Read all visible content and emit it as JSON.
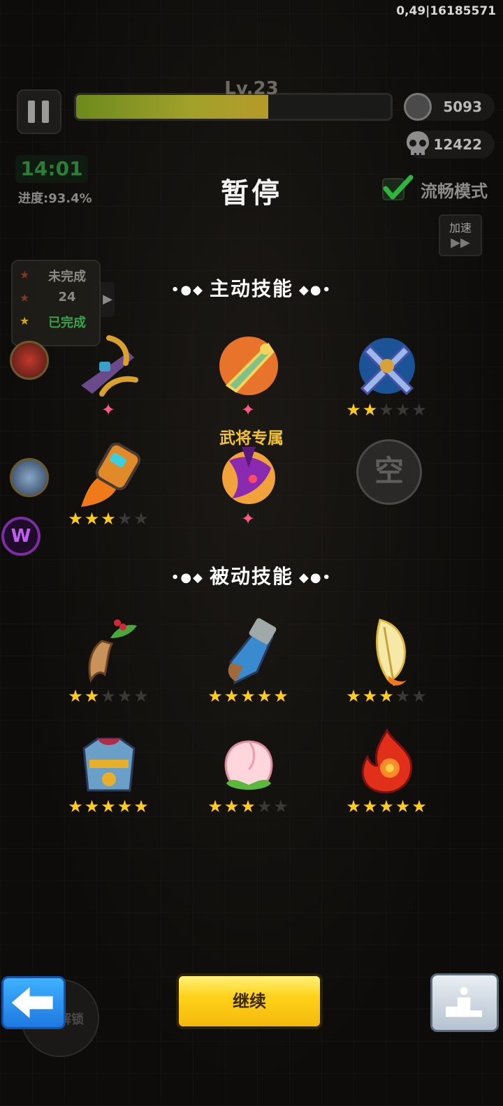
{
  "debug_text": "0,49|16185571",
  "hud": {
    "level": "Lv.23",
    "xp_fraction": 0.61,
    "coins": "5093",
    "kills": "12422",
    "timer": "14:01",
    "progress": "进度:93.4%"
  },
  "pause_title": "暂停",
  "smooth_mode": {
    "label": "流畅模式",
    "checked": true
  },
  "speed_button": {
    "label": "加速",
    "icon": "fast-forward-icon"
  },
  "quest": {
    "rows": [
      {
        "label": "未完成",
        "star_color": "#7a3a22",
        "text_color": "#8c8a86"
      },
      {
        "label": "24",
        "star_color": "#7a3a22",
        "text_color": "#8c8a86"
      },
      {
        "label": "已完成",
        "star_color": "#d5a21a",
        "text_color": "#3aa24a"
      }
    ]
  },
  "active_section": {
    "title": "主动技能",
    "dots_left": "•●◆",
    "dots_right": "◆●•"
  },
  "passive_section": {
    "title": "被动技能",
    "dots_left": "•●◆",
    "dots_right": "◆●•"
  },
  "exclusive_label": "武将专属",
  "empty_slot_label": "空",
  "active_skills": [
    {
      "icon": "crossbow-icon",
      "kind": "pink",
      "stars": 1,
      "max": 1
    },
    {
      "icon": "jade-sword-icon",
      "kind": "pink",
      "stars": 1,
      "max": 1
    },
    {
      "icon": "blue-crossed-swords-icon",
      "kind": "gold",
      "stars": 2,
      "max": 5
    },
    {
      "icon": "rocket-fist-icon",
      "kind": "gold",
      "stars": 3,
      "max": 5
    },
    {
      "icon": "dark-blade-icon",
      "kind": "pink",
      "stars": 1,
      "max": 1
    },
    {
      "icon": "empty-slot",
      "kind": "empty",
      "stars": 0,
      "max": 0
    }
  ],
  "passive_skills": [
    {
      "icon": "ginseng-icon",
      "stars": 2,
      "max": 5
    },
    {
      "icon": "gauntlet-icon",
      "stars": 5,
      "max": 5
    },
    {
      "icon": "feather-icon",
      "stars": 3,
      "max": 5
    },
    {
      "icon": "armor-icon",
      "stars": 5,
      "max": 5
    },
    {
      "icon": "peach-icon",
      "stars": 3,
      "max": 5
    },
    {
      "icon": "fire-icon",
      "stars": 5,
      "max": 5
    }
  ],
  "buttons": {
    "back_icon": "back-arrow-icon",
    "lock_label": "解锁",
    "continue": "继续",
    "rank_icon": "podium-icon"
  },
  "colors": {
    "accent_gold": "#ffcc1a",
    "exclusive_pink": "#ff5a86",
    "xp_green": "#8a9a22"
  }
}
